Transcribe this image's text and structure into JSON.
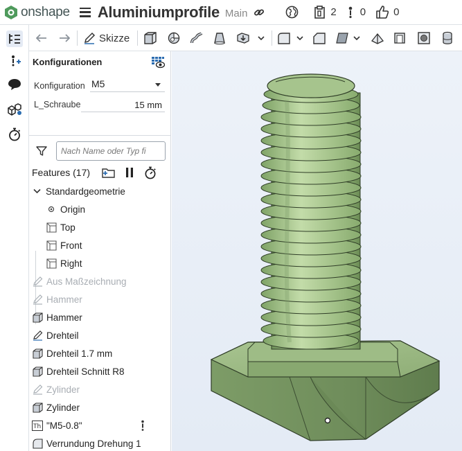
{
  "app": {
    "name": "onshape",
    "document_title": "Aluminiumprofile",
    "branch": "Main",
    "versions_count": "2",
    "comments_count": "0",
    "likes_count": "0"
  },
  "toolbar": {
    "sketch_label": "Skizze"
  },
  "configurations": {
    "title": "Konfigurationen",
    "config_label": "Konfiguration",
    "config_value": "M5",
    "param_label": "L_Schraube",
    "param_value": "15 mm"
  },
  "features": {
    "search_placeholder": "Nach Name oder Typ fi",
    "header": "Features (17)",
    "group_name": "Standardgeometrie",
    "items": [
      {
        "label": "Origin",
        "icon": "origin-icon",
        "suppressed": false
      },
      {
        "label": "Top",
        "icon": "plane-icon",
        "suppressed": false
      },
      {
        "label": "Front",
        "icon": "plane-icon",
        "suppressed": false
      },
      {
        "label": "Right",
        "icon": "plane-icon",
        "suppressed": false
      },
      {
        "label": "Aus Maßzeichnung",
        "icon": "sketch-icon",
        "suppressed": true
      },
      {
        "label": "Hammer",
        "icon": "sketch-icon",
        "suppressed": true
      },
      {
        "label": "Hammer",
        "icon": "extrude-icon",
        "suppressed": false
      },
      {
        "label": "Drehteil",
        "icon": "sketch-icon",
        "suppressed": false
      },
      {
        "label": "Drehteil 1.7 mm",
        "icon": "extrude-icon",
        "suppressed": false
      },
      {
        "label": "Drehteil Schnitt R8",
        "icon": "extrude-icon",
        "suppressed": false
      },
      {
        "label": "Zylinder",
        "icon": "sketch-icon",
        "suppressed": true
      },
      {
        "label": "Zylinder",
        "icon": "extrude-icon",
        "suppressed": false
      },
      {
        "label": "\"M5-0.8\"",
        "icon": "thread-text-icon",
        "suppressed": false
      },
      {
        "label": "Verrundung Drehung 1",
        "icon": "fillet-icon",
        "suppressed": false
      }
    ]
  },
  "colors": {
    "accent": "#2b6cb0",
    "model_green": "#9cbd84",
    "model_dark": "#5e7e4a",
    "viewport_bg": "#e9eff7"
  }
}
